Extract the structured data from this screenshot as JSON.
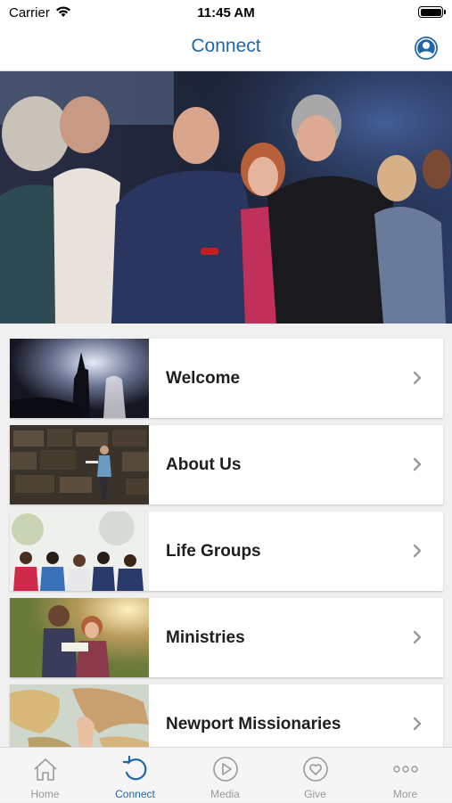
{
  "status": {
    "carrier": "Carrier",
    "time": "11:45 AM"
  },
  "nav": {
    "title": "Connect"
  },
  "items": [
    {
      "label": "Welcome"
    },
    {
      "label": "About Us"
    },
    {
      "label": "Life Groups"
    },
    {
      "label": "Ministries"
    },
    {
      "label": "Newport Missionaries"
    }
  ],
  "tabs": [
    {
      "label": "Home",
      "icon": "home-icon"
    },
    {
      "label": "Connect",
      "icon": "connect-icon"
    },
    {
      "label": "Media",
      "icon": "play-icon"
    },
    {
      "label": "Give",
      "icon": "heart-icon"
    },
    {
      "label": "More",
      "icon": "more-icon"
    }
  ],
  "colors": {
    "accent": "#2266a8",
    "tab_inactive": "#9a9a9a",
    "background": "#f0f0f0"
  }
}
